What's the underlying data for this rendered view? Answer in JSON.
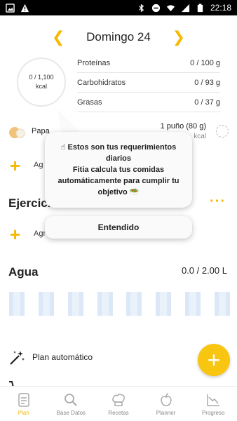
{
  "status_bar": {
    "time": "22:18"
  },
  "header": {
    "day_title": "Domingo 24",
    "prev_icon": "chevron-left-icon",
    "next_icon": "chevron-right-icon"
  },
  "summary": {
    "kcal_value": "0 / 1,100",
    "kcal_unit": "kcal",
    "macros": [
      {
        "label": "Proteínas",
        "value": "0 / 100 g"
      },
      {
        "label": "Carbohidratos",
        "value": "0 / 93 g"
      },
      {
        "label": "Grasas",
        "value": "0 / 37 g"
      }
    ]
  },
  "meal": {
    "name": "Papa",
    "quantity": "1 puño (80 g)",
    "kcal": "kcal"
  },
  "add_food": {
    "label": "Ag"
  },
  "exercise": {
    "title": "Ejercicio",
    "add_label": "Agr"
  },
  "water": {
    "title": "Agua",
    "value": "0.0 / 2.00 L",
    "glasses": 8
  },
  "auto_plan": {
    "label": "Plan automático"
  },
  "tooltip": {
    "line1": "☝ Estos son tus requerimientos diarios",
    "line2": "Fitia calcula tus comidas automáticamente para cumplir tu objetivo 🥗",
    "button": "Entendido"
  },
  "nav": [
    {
      "label": "Plan",
      "icon": "plan-icon",
      "active": true
    },
    {
      "label": "Base Datos",
      "icon": "search-icon",
      "active": false
    },
    {
      "label": "Recetas",
      "icon": "chef-hat-icon",
      "active": false
    },
    {
      "label": "Planner",
      "icon": "apple-icon",
      "active": false
    },
    {
      "label": "Progreso",
      "icon": "chart-icon",
      "active": false
    }
  ],
  "colors": {
    "accent": "#f6b800",
    "fab": "#f8c511"
  }
}
